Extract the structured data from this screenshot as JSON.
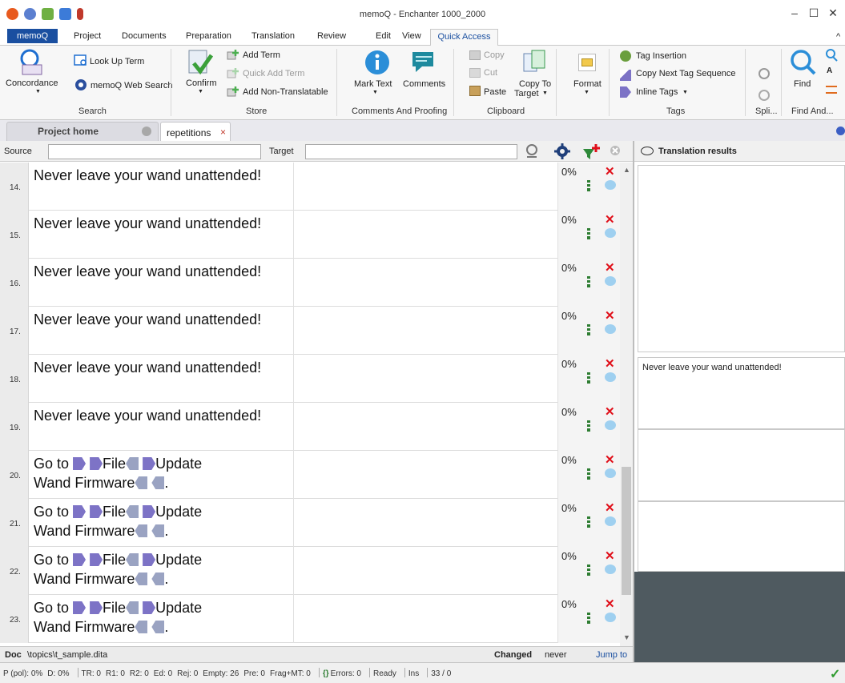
{
  "window": {
    "title": "memoQ - Enchanter 1000_2000",
    "minimize": "–",
    "maximize": "☐",
    "close": "✕"
  },
  "ribbon_tabs": [
    "memoQ",
    "Project",
    "Documents",
    "Preparation",
    "Translation",
    "Review",
    "Edit",
    "View",
    "Quick Access"
  ],
  "ribbon_collapse": "^",
  "ribbon": {
    "concordance": "Concordance",
    "look_up_term": "Look Up Term",
    "web_search": "memoQ Web Search",
    "search_group": "Search",
    "confirm": "Confirm",
    "add_term": "Add Term",
    "quick_add_term": "Quick Add Term",
    "add_non_translatable": "Add Non-Translatable",
    "store_group": "Store",
    "mark_text": "Mark Text",
    "comments": "Comments",
    "comments_group": "Comments And Proofing",
    "copy": "Copy",
    "cut": "Cut",
    "paste": "Paste",
    "copy_to_target_1": "Copy To",
    "copy_to_target_2": "Target",
    "clipboard_group": "Clipboard",
    "format": "Format",
    "tag_insertion": "Tag Insertion",
    "copy_next_tag": "Copy Next Tag Sequence",
    "inline_tags": "Inline Tags",
    "tags_group": "Tags",
    "split_group": "Spli...",
    "find": "Find",
    "find_group": "Find And..."
  },
  "doc_tabs": {
    "project_home": "Project home",
    "repetitions": "repetitions",
    "close_glyph": "×"
  },
  "filter": {
    "source_label": "Source",
    "target_label": "Target",
    "source_value": "",
    "target_value": ""
  },
  "rows": [
    {
      "num": "14.",
      "text": "Never leave your wand unattended!",
      "pct": "0%"
    },
    {
      "num": "15.",
      "text": "Never leave your wand unattended!",
      "pct": "0%"
    },
    {
      "num": "16.",
      "text": "Never leave your wand unattended!",
      "pct": "0%"
    },
    {
      "num": "17.",
      "text": "Never leave your wand unattended!",
      "pct": "0%"
    },
    {
      "num": "18.",
      "text": "Never leave your wand unattended!",
      "pct": "0%"
    },
    {
      "num": "19.",
      "text": "Never leave your wand unattended!",
      "pct": "0%"
    },
    {
      "num": "20.",
      "text": "Go to File Update Wand Firmware.",
      "pct": "0%",
      "tagged": true
    },
    {
      "num": "21.",
      "text": "Go to File Update Wand Firmware.",
      "pct": "0%",
      "tagged": true
    },
    {
      "num": "22.",
      "text": "Go to File Update Wand Firmware.",
      "pct": "0%",
      "tagged": true
    },
    {
      "num": "23.",
      "text": "Go to File Update Wand Firmware.",
      "pct": "0%",
      "tagged": true
    }
  ],
  "tagged_parts": {
    "go_to": "Go to ",
    "file": "File",
    "update": "Update",
    "wand_firmware": "Wand Firmware",
    "period": "."
  },
  "status_glyphs": {
    "reject": "✕"
  },
  "doc_bar": {
    "doc_label": "Doc",
    "path": "\\topics\\t_sample.dita",
    "changed_label": "Changed",
    "changed_value": "never",
    "jump_to": "Jump to"
  },
  "status_bar": {
    "pol": "P (pol): 0%",
    "d": "D: 0%",
    "tr": "TR: 0",
    "r1": "R1: 0",
    "r2": "R2: 0",
    "ed": "Ed: 0",
    "rej": "Rej: 0",
    "empty": "Empty: 26",
    "pre": "Pre: 0",
    "frag": "Frag+MT: 0",
    "errors": "Errors: 0",
    "ready": "Ready",
    "ins": "Ins",
    "count": "33 / 0",
    "check": "✓"
  },
  "right_panel": {
    "header": "Translation results",
    "preview_text": "Never leave your wand unattended!"
  },
  "colors": {
    "accent": "#1a4fa0",
    "reject": "#e0101a",
    "tag_open": "#7d73c6",
    "tag_close": "#9aa3c2"
  }
}
